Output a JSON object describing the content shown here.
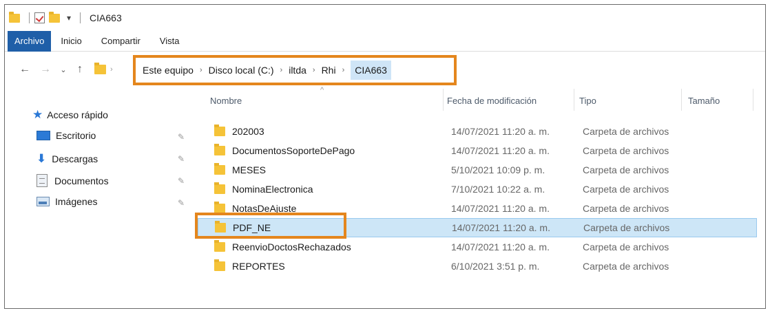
{
  "window": {
    "title": "CIA663"
  },
  "ribbon": {
    "tabs": [
      "Archivo",
      "Inicio",
      "Compartir",
      "Vista"
    ]
  },
  "address": {
    "crumbs": [
      "Este equipo",
      "Disco local (C:)",
      "iltda",
      "Rhi",
      "CIA663"
    ]
  },
  "navpane": {
    "quick_access": "Acceso rápido",
    "items": [
      {
        "label": "Escritorio",
        "icon": "desktop-icon",
        "pinned": true
      },
      {
        "label": "Descargas",
        "icon": "download-icon",
        "pinned": true
      },
      {
        "label": "Documentos",
        "icon": "documents-icon",
        "pinned": true
      },
      {
        "label": "Imágenes",
        "icon": "pictures-icon",
        "pinned": true
      }
    ]
  },
  "columns": [
    "Nombre",
    "Fecha de modificación",
    "Tipo",
    "Tamaño"
  ],
  "files": [
    {
      "name": "202003",
      "date": "14/07/2021 11:20 a. m.",
      "type": "Carpeta de archivos"
    },
    {
      "name": "DocumentosSoporteDePago",
      "date": "14/07/2021 11:20 a. m.",
      "type": "Carpeta de archivos"
    },
    {
      "name": "MESES",
      "date": "5/10/2021 10:09 p. m.",
      "type": "Carpeta de archivos"
    },
    {
      "name": "NominaElectronica",
      "date": "7/10/2021 10:22 a. m.",
      "type": "Carpeta de archivos"
    },
    {
      "name": "NotasDeAjuste",
      "date": "14/07/2021 11:20 a. m.",
      "type": "Carpeta de archivos"
    },
    {
      "name": "PDF_NE",
      "date": "14/07/2021 11:20 a. m.",
      "type": "Carpeta de archivos",
      "selected": true
    },
    {
      "name": "ReenvioDoctosRechazados",
      "date": "14/07/2021 11:20 a. m.",
      "type": "Carpeta de archivos"
    },
    {
      "name": "REPORTES",
      "date": "6/10/2021 3:51 p. m.",
      "type": "Carpeta de archivos"
    }
  ],
  "colors": {
    "accent": "#1f5fa8",
    "highlight": "#e4861d",
    "selection": "#cde6f7",
    "folder": "#f5c338"
  }
}
